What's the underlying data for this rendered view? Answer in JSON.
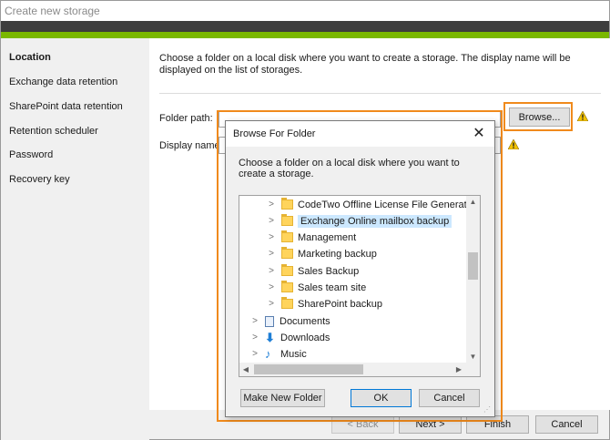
{
  "window": {
    "title": "Create new storage"
  },
  "sidebar": {
    "items": [
      {
        "label": "Location",
        "active": true
      },
      {
        "label": "Exchange data retention"
      },
      {
        "label": "SharePoint data retention"
      },
      {
        "label": "Retention scheduler"
      },
      {
        "label": "Password"
      },
      {
        "label": "Recovery key"
      }
    ]
  },
  "main": {
    "description": "Choose a folder on a local disk where you want to create a storage. The display name will be displayed on the list of storages.",
    "folder_path_label": "Folder path:",
    "folder_path_value": "",
    "display_name_label": "Display name:",
    "display_name_value": "",
    "browse_label": "Browse..."
  },
  "footer": {
    "back_label": "< Back",
    "next_label": "Next >",
    "finish_label": "Finish",
    "cancel_label": "Cancel"
  },
  "dialog": {
    "title": "Browse For Folder",
    "close_glyph": "✕",
    "description": "Choose a folder on a local disk where you want to create a storage.",
    "tree": [
      {
        "label": "CodeTwo Offline License File Generat",
        "icon": "folder-icon",
        "depth": 2
      },
      {
        "label": "Exchange Online mailbox backup",
        "icon": "folder-icon",
        "depth": 2,
        "selected": true
      },
      {
        "label": "Management",
        "icon": "folder-icon",
        "depth": 2
      },
      {
        "label": "Marketing backup",
        "icon": "folder-icon",
        "depth": 2
      },
      {
        "label": "Sales Backup",
        "icon": "folder-icon",
        "depth": 2
      },
      {
        "label": "Sales team site",
        "icon": "folder-icon",
        "depth": 2
      },
      {
        "label": "SharePoint backup",
        "icon": "folder-icon",
        "depth": 2
      },
      {
        "label": "Documents",
        "icon": "documents-icon",
        "depth": 1
      },
      {
        "label": "Downloads",
        "icon": "downloads-icon",
        "depth": 1
      },
      {
        "label": "Music",
        "icon": "music-icon",
        "depth": 1
      }
    ],
    "make_new_folder_label": "Make New Folder",
    "ok_label": "OK",
    "cancel_label": "Cancel"
  },
  "colors": {
    "accent_green": "#7ab800",
    "highlight_orange": "#f08a1c",
    "selection": "#cce8ff"
  }
}
